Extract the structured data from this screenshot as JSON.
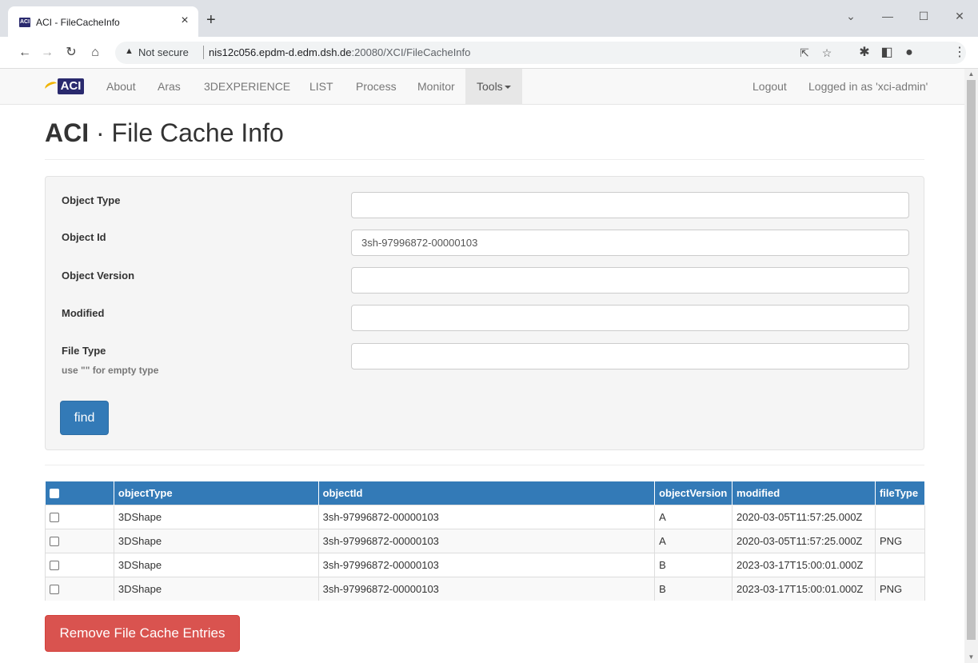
{
  "browser": {
    "tab_title": "ACI - FileCacheInfo",
    "tab_favicon_text": "ACI",
    "tab_close": "×",
    "new_tab": "+",
    "window_minimize": "—",
    "window_maximize": "☐",
    "window_close": "✕",
    "window_menu": "⌄",
    "security_label": "Not secure",
    "url_host": "nis12c056.epdm-d.edm.dsh.de",
    "url_path": ":20080/XCI/FileCacheInfo"
  },
  "navbar": {
    "brand": "ACI",
    "items": [
      "About",
      "Aras",
      "3DEXPERIENCE",
      "LIST",
      "Process",
      "Monitor"
    ],
    "tools": "Tools",
    "logout": "Logout",
    "logged_in": "Logged in as 'xci-admin'"
  },
  "header": {
    "brand": "ACI",
    "title": " · File Cache Info"
  },
  "form": {
    "object_type_label": "Object Type",
    "object_type_value": "",
    "object_id_label": "Object Id",
    "object_id_value": "3sh-97996872-00000103",
    "object_version_label": "Object Version",
    "object_version_value": "",
    "modified_label": "Modified",
    "modified_value": "",
    "file_type_label": "File Type",
    "file_type_hint": "use \"\" for empty type",
    "file_type_value": "",
    "find_label": "find"
  },
  "table": {
    "columns": [
      "objectType",
      "objectId",
      "objectVersion",
      "modified",
      "fileType"
    ],
    "rows": [
      [
        "3DShape",
        "3sh-97996872-00000103",
        "A",
        "2020-03-05T11:57:25.000Z",
        ""
      ],
      [
        "3DShape",
        "3sh-97996872-00000103",
        "A",
        "2020-03-05T11:57:25.000Z",
        "PNG"
      ],
      [
        "3DShape",
        "3sh-97996872-00000103",
        "B",
        "2023-03-17T15:00:01.000Z",
        ""
      ],
      [
        "3DShape",
        "3sh-97996872-00000103",
        "B",
        "2023-03-17T15:00:01.000Z",
        "PNG"
      ]
    ]
  },
  "remove_button_label": "Remove File Cache Entries",
  "colors": {
    "primary": "#337ab7",
    "danger": "#d9534f",
    "brand": "#2a2a6e"
  }
}
